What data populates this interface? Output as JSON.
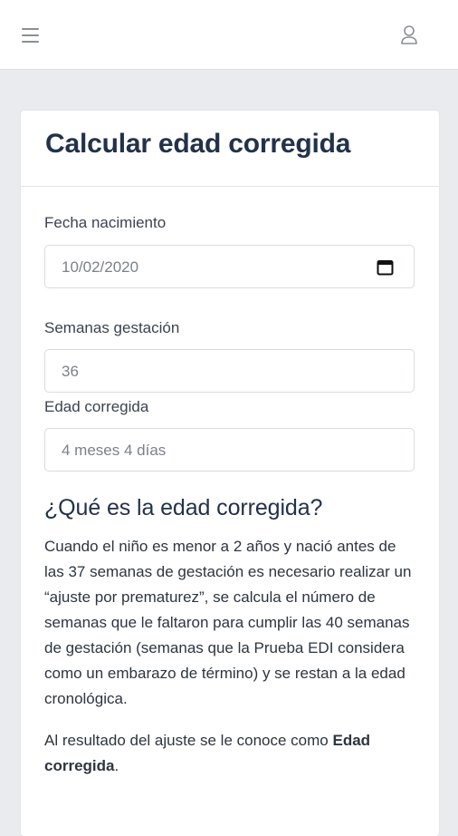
{
  "header": {
    "menu_icon": "hamburger-menu-icon",
    "user_icon": "user-profile-icon"
  },
  "card": {
    "title": "Calcular edad corregida"
  },
  "form": {
    "birth_date_label": "Fecha nacimiento",
    "birth_date_value": "10/02/2020",
    "calendar_icon": "calendar-icon",
    "gestation_weeks_label": "Semanas gestación",
    "gestation_weeks_value": "36",
    "corrected_age_label": "Edad corregida",
    "corrected_age_value": "4 meses 4 días"
  },
  "info": {
    "title": "¿Qué es la edad corregida?",
    "paragraph1": "Cuando el niño es menor a 2 años y nació antes de las 37 semanas de gestación es necesario realizar un “ajuste por prematurez”, se calcula el número de semanas que le faltaron para cumplir las 40 semanas de gestación (semanas que la Prueba EDI considera como un embarazo de término) y se restan a la edad cronológica.",
    "paragraph2_prefix": "Al resultado del ajuste se le conoce como",
    "paragraph2_bold": "Edad corregida",
    "paragraph2_suffix": "."
  },
  "colors": {
    "page_background": "#e9ebee",
    "title": "#22324a",
    "text": "#2d3540"
  }
}
